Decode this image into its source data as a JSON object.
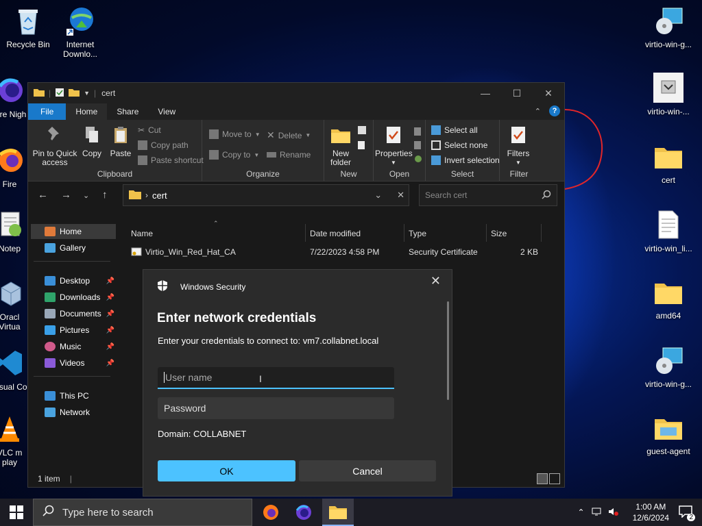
{
  "desktop": {
    "icons_left": [
      {
        "label": "Recycle Bin"
      },
      {
        "label": "Internet Downlo..."
      },
      {
        "label": "Fire Nigh"
      },
      {
        "label": "Fire"
      },
      {
        "label": "Notep"
      },
      {
        "label": "Oracl Virtua"
      },
      {
        "label": "Visual Co"
      },
      {
        "label": "VLC m play"
      }
    ],
    "icons_right": [
      {
        "label": "virtio-win-g..."
      },
      {
        "label": "virtio-win-..."
      },
      {
        "label": "cert"
      },
      {
        "label": "virtio-win_li..."
      },
      {
        "label": "amd64"
      },
      {
        "label": "virtio-win-g..."
      },
      {
        "label": "guest-agent"
      }
    ],
    "annotation_color": "#e0262a"
  },
  "explorer": {
    "title": "cert",
    "tabs": {
      "file": "File",
      "home": "Home",
      "share": "Share",
      "view": "View"
    },
    "ribbon": {
      "clipboard": {
        "pin": "Pin to Quick access",
        "copy": "Copy",
        "paste": "Paste",
        "cut": "Cut",
        "copy_path": "Copy path",
        "paste_shortcut": "Paste shortcut",
        "group": "Clipboard"
      },
      "organize": {
        "move_to": "Move to",
        "copy_to": "Copy to",
        "delete": "Delete",
        "rename": "Rename",
        "group": "Organize"
      },
      "new": {
        "new_folder": "New folder",
        "group": "New"
      },
      "open": {
        "properties": "Properties",
        "group": "Open"
      },
      "select": {
        "select_all": "Select all",
        "select_none": "Select none",
        "invert": "Invert selection",
        "group": "Select"
      },
      "filter": {
        "filters": "Filters",
        "group": "Filter"
      }
    },
    "address": {
      "crumb": "cert",
      "search_placeholder": "Search cert"
    },
    "nav": {
      "home": "Home",
      "gallery": "Gallery",
      "quick": [
        "Desktop",
        "Downloads",
        "Documents",
        "Pictures",
        "Music",
        "Videos"
      ],
      "this_pc": "This PC",
      "network": "Network"
    },
    "columns": {
      "name": "Name",
      "date": "Date modified",
      "type": "Type",
      "size": "Size"
    },
    "files": [
      {
        "name": "Virtio_Win_Red_Hat_CA",
        "date": "7/22/2023 4:58 PM",
        "type": "Security Certificate",
        "size": "2 KB"
      }
    ],
    "status": "1 item"
  },
  "dialog": {
    "app": "Windows Security",
    "heading": "Enter network credentials",
    "subtitle": "Enter your credentials to connect to: vm7.collabnet.local",
    "username_placeholder": "User name",
    "password_placeholder": "Password",
    "domain": "Domain: COLLABNET",
    "ok": "OK",
    "cancel": "Cancel"
  },
  "taskbar": {
    "search_placeholder": "Type here to search",
    "time": "1:00 AM",
    "date": "12/6/2024",
    "notifications": "2"
  }
}
